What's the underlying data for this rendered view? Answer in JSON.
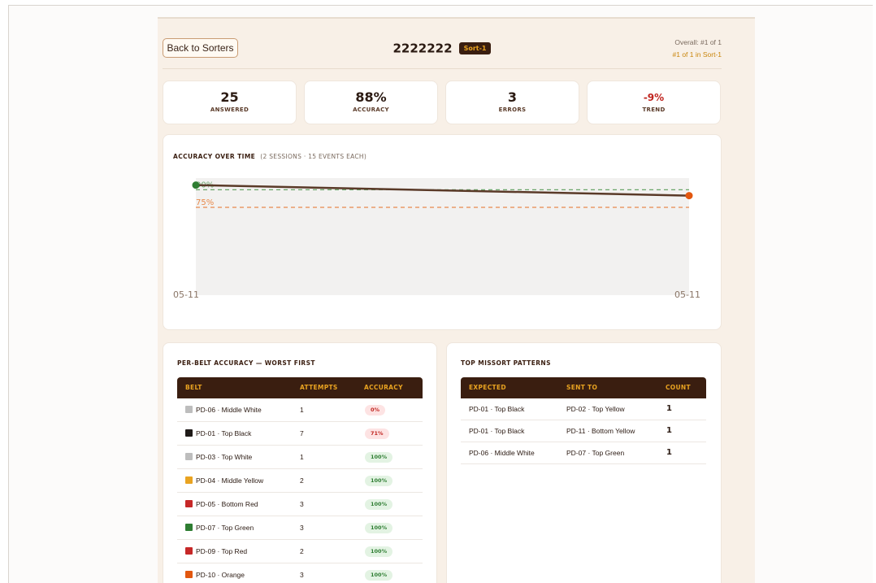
{
  "header": {
    "back_label": "Back to Sorters",
    "sorter_id": "2222222",
    "sort_badge": "Sort-1",
    "rank_overall": "Overall: #1 of 1",
    "rank_group": "#1 of 1 in Sort-1"
  },
  "stats": [
    {
      "value": "25",
      "label": "ANSWERED"
    },
    {
      "value": "88%",
      "label": "ACCURACY"
    },
    {
      "value": "3",
      "label": "ERRORS"
    },
    {
      "value": "-9%",
      "label": "TREND"
    }
  ],
  "chart": {
    "title": "ACCURACY OVER TIME",
    "subtitle": "(2 SESSIONS · 15 EVENTS EACH)"
  },
  "chart_data": {
    "type": "line",
    "x": [
      "05-11",
      "05-11"
    ],
    "series": [
      {
        "values": [
          94,
          85
        ]
      }
    ],
    "reference_lines": [
      {
        "label": "90%",
        "value": 90,
        "color": "#6aa56a",
        "style": "dashed"
      },
      {
        "label": "75%",
        "value": 75,
        "color": "#e88a4c",
        "style": "dashed"
      }
    ],
    "ylim": [
      0,
      100
    ],
    "grid": false,
    "colors": {
      "line": "#5a3a28",
      "start_point": "#2e7d32",
      "end_point": "#e2570f",
      "area": "#f2f1f0"
    }
  },
  "belt_table": {
    "title": "PER-BELT ACCURACY — WORST FIRST",
    "columns": [
      "BELT",
      "ATTEMPTS",
      "ACCURACY"
    ],
    "rows": [
      {
        "belt": "PD-06 · Middle White",
        "attempts": "1",
        "accuracy": "0%",
        "color": "#bdbdbd",
        "status": "bad"
      },
      {
        "belt": "PD-01 · Top Black",
        "attempts": "7",
        "accuracy": "71%",
        "color": "#1f1a18",
        "status": "bad"
      },
      {
        "belt": "PD-03 · Top White",
        "attempts": "1",
        "accuracy": "100%",
        "color": "#bdbdbd",
        "status": "good"
      },
      {
        "belt": "PD-04 · Middle Yellow",
        "attempts": "2",
        "accuracy": "100%",
        "color": "#e9a321",
        "status": "good"
      },
      {
        "belt": "PD-05 · Bottom Red",
        "attempts": "3",
        "accuracy": "100%",
        "color": "#c62828",
        "status": "good"
      },
      {
        "belt": "PD-07 · Top Green",
        "attempts": "3",
        "accuracy": "100%",
        "color": "#2e7d32",
        "status": "good"
      },
      {
        "belt": "PD-09 · Top Red",
        "attempts": "2",
        "accuracy": "100%",
        "color": "#c62828",
        "status": "good"
      },
      {
        "belt": "PD-10 · Orange",
        "attempts": "3",
        "accuracy": "100%",
        "color": "#e2570f",
        "status": "good"
      }
    ]
  },
  "missort_table": {
    "title": "TOP MISSORT PATTERNS",
    "columns": [
      "EXPECTED",
      "SENT TO",
      "COUNT"
    ],
    "rows": [
      {
        "expected": "PD-01 · Top Black",
        "sent_to": "PD-02 · Top Yellow",
        "count": "1"
      },
      {
        "expected": "PD-01 · Top Black",
        "sent_to": "PD-11 · Bottom Yellow",
        "count": "1"
      },
      {
        "expected": "PD-06 · Middle White",
        "sent_to": "PD-07 · Top Green",
        "count": "1"
      }
    ]
  }
}
